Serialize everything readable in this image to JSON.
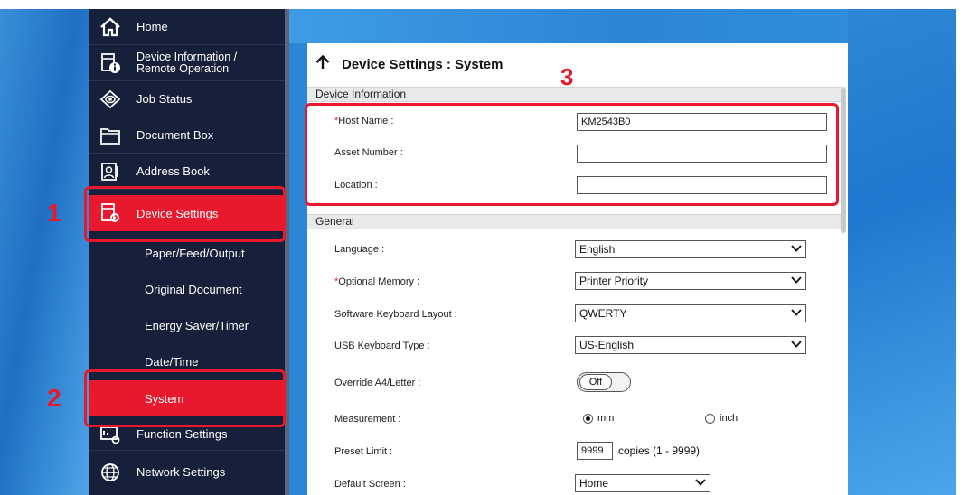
{
  "sidebar": {
    "items": [
      {
        "label": "Home",
        "icon": "home-icon"
      },
      {
        "label": "Device Information /",
        "label2": "Remote Operation",
        "icon": "device-info-icon"
      },
      {
        "label": "Job Status",
        "icon": "eye-icon"
      },
      {
        "label": "Document Box",
        "icon": "folder-icon"
      },
      {
        "label": "Address Book",
        "icon": "address-book-icon"
      },
      {
        "label": "Device Settings",
        "icon": "device-settings-icon",
        "active": true
      }
    ],
    "subitems": [
      {
        "label": "Paper/Feed/Output"
      },
      {
        "label": "Original Document"
      },
      {
        "label": "Energy Saver/Timer"
      },
      {
        "label": "Date/Time"
      },
      {
        "label": "System",
        "active": true
      }
    ],
    "bottom_items": [
      {
        "label": "Function Settings",
        "icon": "function-settings-icon"
      },
      {
        "label": "Network Settings",
        "icon": "network-globe-icon"
      }
    ]
  },
  "callouts": {
    "one": "1",
    "two": "2",
    "three": "3"
  },
  "panel": {
    "title": "Device Settings : System",
    "sections": {
      "device_information": "Device Information",
      "general": "General"
    },
    "device_information": {
      "host_name": {
        "label": "Host Name :",
        "required": "*",
        "value": "KM2543B0"
      },
      "asset_number": {
        "label": "Asset Number :",
        "value": ""
      },
      "location": {
        "label": "Location :",
        "value": ""
      }
    },
    "general": {
      "language": {
        "label": "Language :",
        "value": "English"
      },
      "optional_memory": {
        "label": "Optional Memory :",
        "required": "*",
        "value": "Printer Priority"
      },
      "keyboard_layout": {
        "label": "Software Keyboard Layout :",
        "value": "QWERTY"
      },
      "usb_keyboard": {
        "label": "USB Keyboard Type :",
        "value": "US-English"
      },
      "override": {
        "label": "Override A4/Letter :",
        "value": "Off"
      },
      "measurement": {
        "label": "Measurement :",
        "option_mm": "mm",
        "option_inch": "inch"
      },
      "preset_limit": {
        "label": "Preset Limit :",
        "value": "9999",
        "suffix": "copies (1 - 9999)"
      },
      "default_screen": {
        "label": "Default Screen :",
        "value": "Home"
      }
    }
  },
  "colors": {
    "accent": "#e8192c",
    "sidebar": "#17203a"
  }
}
